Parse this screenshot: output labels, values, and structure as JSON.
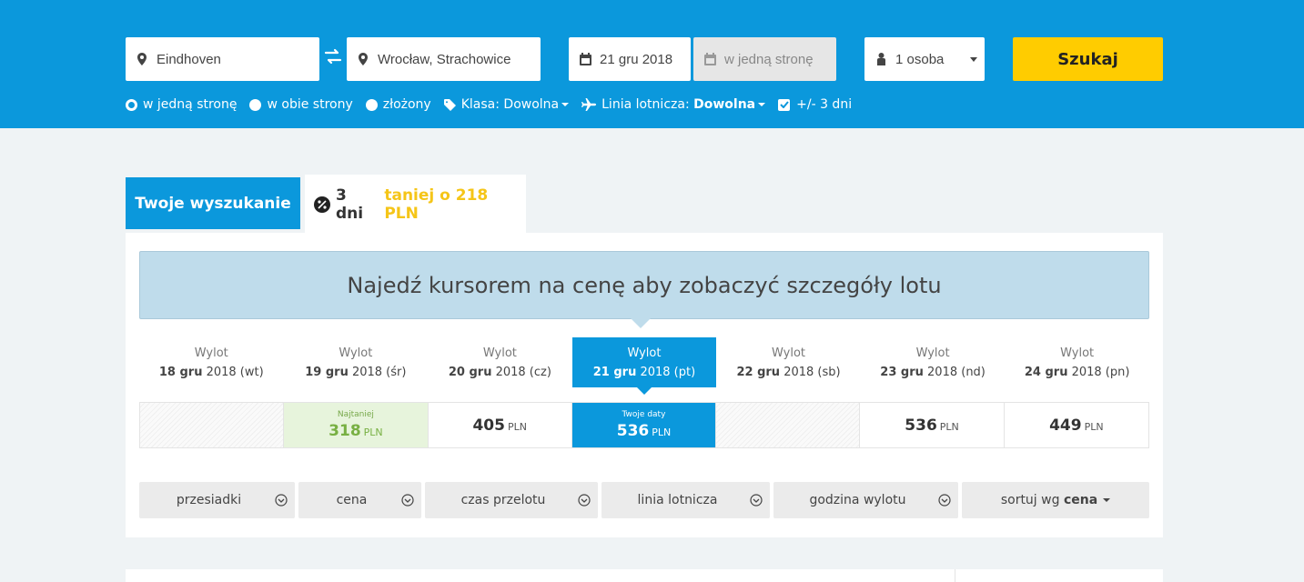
{
  "search": {
    "from": "Eindhoven",
    "to": "Wrocław, Strachowice",
    "date": "21 gru 2018",
    "return_placeholder": "w jedną stronę",
    "passengers": "1 osoba",
    "button": "Szukaj"
  },
  "options": {
    "one_way": "w jedną stronę",
    "round_trip": "w obie strony",
    "multi": "złożony",
    "class_label": "Klasa: Dowolna",
    "airline_prefix": "Linia lotnicza: ",
    "airline_value": "Dowolna",
    "flex_days": "+/- 3 dni"
  },
  "tabs": {
    "your_search": "Twoje wyszukanie",
    "cheaper_prefix": "3 dni",
    "cheaper_text": "taniej o 218 PLN"
  },
  "hint": "Najedź kursorem na cenę aby zobaczyć szczegóły lotu",
  "date_label": "Wylot",
  "dates": [
    {
      "day": "18 gru",
      "rest": "2018 (wt)"
    },
    {
      "day": "19 gru",
      "rest": "2018 (śr)"
    },
    {
      "day": "20 gru",
      "rest": "2018 (cz)"
    },
    {
      "day": "21 gru",
      "rest": "2018 (pt)"
    },
    {
      "day": "22 gru",
      "rest": "2018 (sb)"
    },
    {
      "day": "23 gru",
      "rest": "2018 (nd)"
    },
    {
      "day": "24 gru",
      "rest": "2018 (pn)"
    }
  ],
  "prices": [
    {
      "tag": "",
      "amount": "",
      "currency": ""
    },
    {
      "tag": "Najtaniej",
      "amount": "318",
      "currency": "PLN"
    },
    {
      "tag": "",
      "amount": "405",
      "currency": "PLN"
    },
    {
      "tag": "Twoje daty",
      "amount": "536",
      "currency": "PLN"
    },
    {
      "tag": "",
      "amount": "",
      "currency": ""
    },
    {
      "tag": "",
      "amount": "536",
      "currency": "PLN"
    },
    {
      "tag": "",
      "amount": "449",
      "currency": "PLN"
    }
  ],
  "filters": {
    "stops": "przesiadki",
    "price": "cena",
    "duration": "czas przelotu",
    "airline": "linia lotnicza",
    "departure": "godzina wylotu",
    "sort_prefix": "sortuj wg ",
    "sort_value": "cena"
  },
  "colors": {
    "brand_blue": "#0b98dc",
    "accent_yellow": "#ffcc00",
    "cheap_green": "#78b043"
  }
}
